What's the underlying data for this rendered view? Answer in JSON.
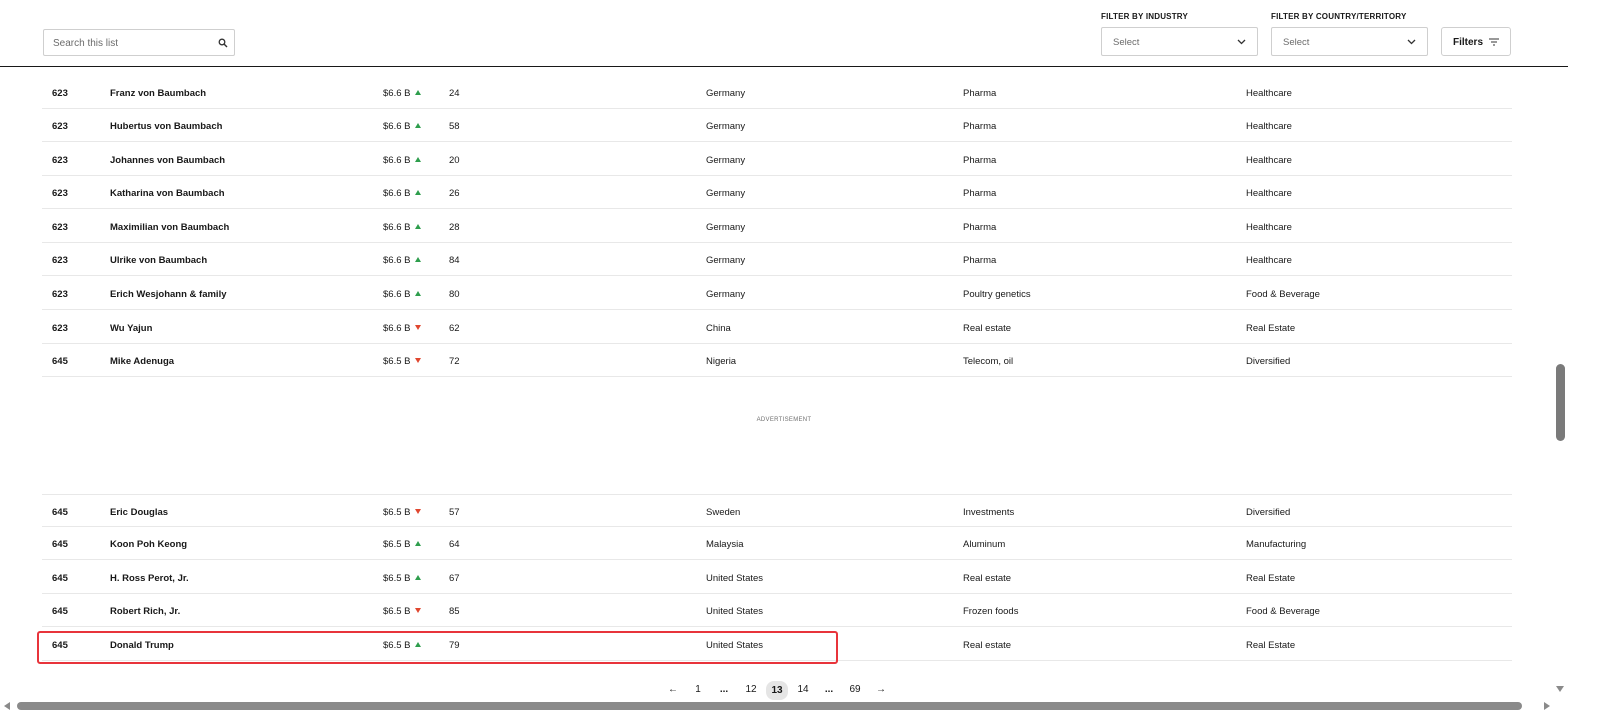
{
  "search": {
    "placeholder": "Search this list",
    "icon": "search-icon"
  },
  "filters": {
    "industry_label": "FILTER BY INDUSTRY",
    "industry_value": "Select",
    "country_label": "FILTER BY COUNTRY/TERRITORY",
    "country_value": "Select",
    "filters_button": "Filters"
  },
  "colors": {
    "up": "#2e9e4d",
    "down": "#e0462f",
    "highlight": "#e8343b"
  },
  "rows": [
    {
      "rank": "623",
      "name": "Franz von Baumbach",
      "worth": "$6.6 B",
      "trend": "up",
      "age": "24",
      "country": "Germany",
      "source": "Pharma",
      "industry": "Healthcare"
    },
    {
      "rank": "623",
      "name": "Hubertus von Baumbach",
      "worth": "$6.6 B",
      "trend": "up",
      "age": "58",
      "country": "Germany",
      "source": "Pharma",
      "industry": "Healthcare"
    },
    {
      "rank": "623",
      "name": "Johannes von Baumbach",
      "worth": "$6.6 B",
      "trend": "up",
      "age": "20",
      "country": "Germany",
      "source": "Pharma",
      "industry": "Healthcare"
    },
    {
      "rank": "623",
      "name": "Katharina von Baumbach",
      "worth": "$6.6 B",
      "trend": "up",
      "age": "26",
      "country": "Germany",
      "source": "Pharma",
      "industry": "Healthcare"
    },
    {
      "rank": "623",
      "name": "Maximilian von Baumbach",
      "worth": "$6.6 B",
      "trend": "up",
      "age": "28",
      "country": "Germany",
      "source": "Pharma",
      "industry": "Healthcare"
    },
    {
      "rank": "623",
      "name": "Ulrike von Baumbach",
      "worth": "$6.6 B",
      "trend": "up",
      "age": "84",
      "country": "Germany",
      "source": "Pharma",
      "industry": "Healthcare"
    },
    {
      "rank": "623",
      "name": "Erich Wesjohann & family",
      "worth": "$6.6 B",
      "trend": "up",
      "age": "80",
      "country": "Germany",
      "source": "Poultry genetics",
      "industry": "Food & Beverage"
    },
    {
      "rank": "623",
      "name": "Wu Yajun",
      "worth": "$6.6 B",
      "trend": "down",
      "age": "62",
      "country": "China",
      "source": "Real estate",
      "industry": "Real Estate"
    },
    {
      "rank": "645",
      "name": "Mike Adenuga",
      "worth": "$6.5 B",
      "trend": "down",
      "age": "72",
      "country": "Nigeria",
      "source": "Telecom, oil",
      "industry": "Diversified"
    },
    {
      "rank": "645",
      "name": "Eric Douglas",
      "worth": "$6.5 B",
      "trend": "down",
      "age": "57",
      "country": "Sweden",
      "source": "Investments",
      "industry": "Diversified"
    },
    {
      "rank": "645",
      "name": "Koon Poh Keong",
      "worth": "$6.5 B",
      "trend": "up",
      "age": "64",
      "country": "Malaysia",
      "source": "Aluminum",
      "industry": "Manufacturing"
    },
    {
      "rank": "645",
      "name": "H. Ross Perot, Jr.",
      "worth": "$6.5 B",
      "trend": "up",
      "age": "67",
      "country": "United States",
      "source": "Real estate",
      "industry": "Real Estate"
    },
    {
      "rank": "645",
      "name": "Robert Rich, Jr.",
      "worth": "$6.5 B",
      "trend": "down",
      "age": "85",
      "country": "United States",
      "source": "Frozen foods",
      "industry": "Food & Beverage"
    },
    {
      "rank": "645",
      "name": "Donald Trump",
      "worth": "$6.5 B",
      "trend": "up",
      "age": "79",
      "country": "United States",
      "source": "Real estate",
      "industry": "Real Estate",
      "highlighted": true
    }
  ],
  "ad_label": "ADVERTISEMENT",
  "pagination": {
    "prev": "←",
    "items": [
      "1",
      "...",
      "12",
      "13",
      "14",
      "...",
      "69"
    ],
    "current": "13",
    "next": "→"
  }
}
